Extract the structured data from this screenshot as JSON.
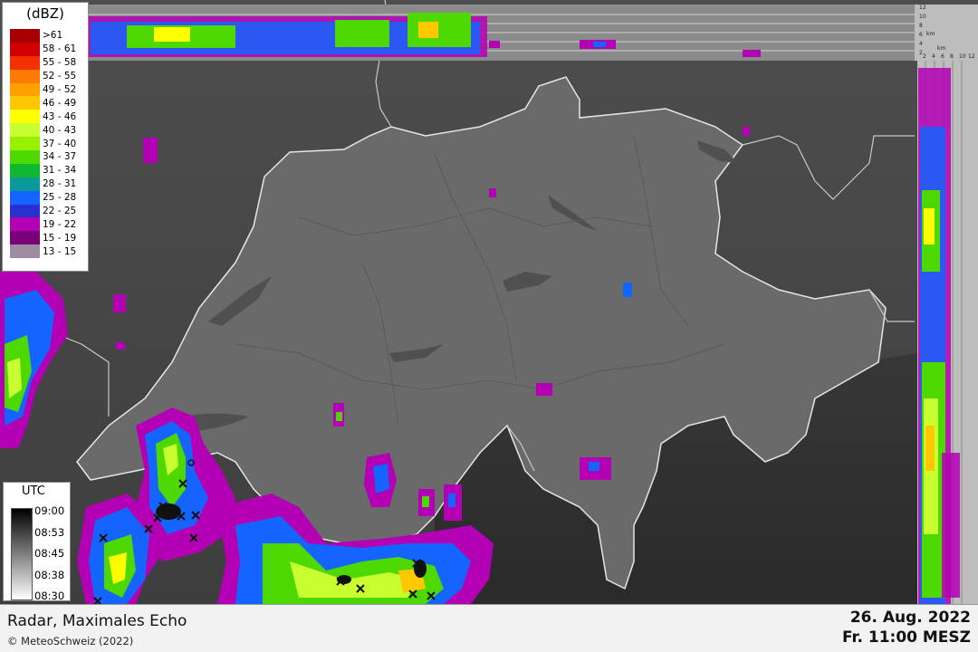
{
  "legend": {
    "unit": "(dBZ)",
    "items": [
      {
        "label": ">61",
        "color": "#a80000"
      },
      {
        "label": "58 - 61",
        "color": "#d00000"
      },
      {
        "label": "55 - 58",
        "color": "#f23000"
      },
      {
        "label": "52 - 55",
        "color": "#ff7a00"
      },
      {
        "label": "49 - 52",
        "color": "#ffa000"
      },
      {
        "label": "46 - 49",
        "color": "#ffc800"
      },
      {
        "label": "43 - 46",
        "color": "#ffff00"
      },
      {
        "label": "40 - 43",
        "color": "#c8ff30"
      },
      {
        "label": "37 - 40",
        "color": "#96f000"
      },
      {
        "label": "34 - 37",
        "color": "#4cd800"
      },
      {
        "label": "31 - 34",
        "color": "#10b830"
      },
      {
        "label": "28 - 31",
        "color": "#0a9a9a"
      },
      {
        "label": "25 - 28",
        "color": "#1464ff"
      },
      {
        "label": "22 - 25",
        "color": "#2830d0"
      },
      {
        "label": "19 - 22",
        "color": "#b400b4"
      },
      {
        "label": "15 - 19",
        "color": "#780078"
      },
      {
        "label": "13 - 15",
        "color": "#a08ca0"
      }
    ]
  },
  "utc_legend": {
    "title": "UTC",
    "ticks": [
      "09:00",
      "08:53",
      "08:45",
      "08:38",
      "08:30"
    ]
  },
  "profile_axes": {
    "top_right": {
      "ticks": [
        "12",
        "10",
        "8",
        "6",
        "4",
        "2"
      ],
      "unit": "km"
    },
    "right_bottom": {
      "ticks": [
        "2",
        "4",
        "6",
        "8",
        "10",
        "12"
      ],
      "unit": "km"
    }
  },
  "footer": {
    "title": "Radar, Maximales Echo",
    "copyright": "© MeteoSchweiz (2022)",
    "date": "26. Aug. 2022",
    "time": "Fr. 11:00 MESZ"
  }
}
